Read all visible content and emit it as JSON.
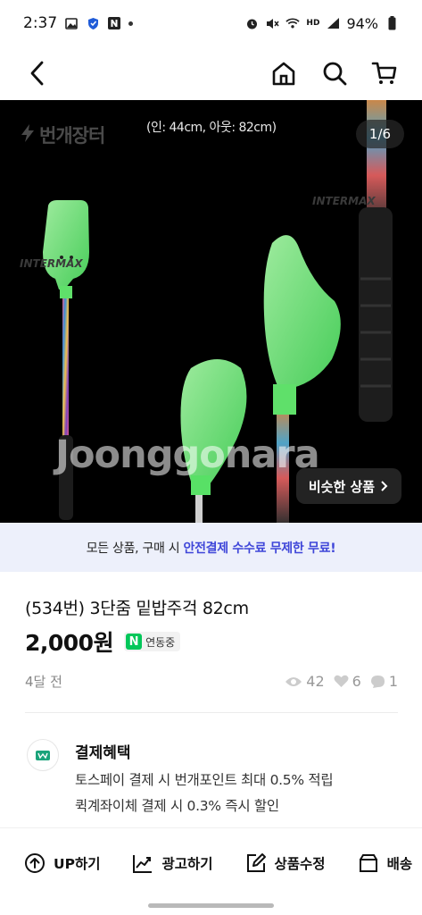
{
  "status_bar": {
    "time": "2:37",
    "hd_label": "HD",
    "battery": "94%"
  },
  "header": {
    "back_icon": "back-arrow-icon",
    "home_icon": "home-icon",
    "search_icon": "search-icon",
    "cart_icon": "cart-icon"
  },
  "hero": {
    "brand": "번개장터",
    "dimensions": "(인: 44cm, 아웃: 82cm)",
    "counter": "1/6",
    "watermark": "Joonggonara",
    "intermax_1": "INTERMAX",
    "intermax_2": "INTERMAX",
    "similar_label": "비슷한 상품"
  },
  "notice": {
    "prefix": "모든 상품, 구매 시 ",
    "highlight": "안전결제 수수료 무제한 무료!"
  },
  "product": {
    "title": "(534번) 3단줌 밑밥주걱 82cm",
    "price": "2,000원",
    "npay_logo": "N",
    "npay_label": "연동중",
    "posted": "4달 전",
    "views": "42",
    "likes": "6",
    "chats": "1"
  },
  "benefit": {
    "title": "결제혜택",
    "line1": "토스페이 결제 시 번개포인트 최대 0.5% 적립",
    "line2": "퀵계좌이체 결제 시 0.3% 즉시 할인"
  },
  "actions": [
    {
      "label": "UP하기",
      "icon": "up-arrow-circle-icon"
    },
    {
      "label": "광고하기",
      "icon": "trend-chart-icon"
    },
    {
      "label": "상품수정",
      "icon": "edit-icon"
    },
    {
      "label": "배송",
      "icon": "box-icon"
    }
  ],
  "colors": {
    "accent": "#3f46d9",
    "npay_green": "#03c75a",
    "notice_bg": "#edf0fb",
    "scoop_green": "#7ef08a"
  }
}
